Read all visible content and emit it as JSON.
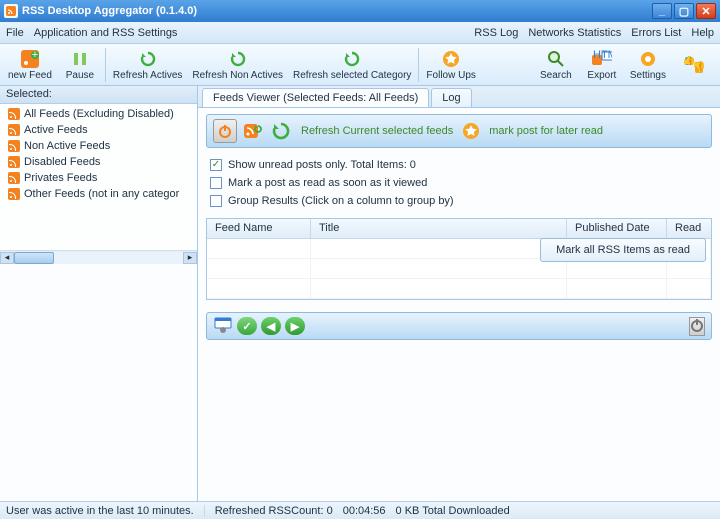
{
  "title": "RSS Desktop Aggregator (0.1.4.0)",
  "menu": {
    "file": "File",
    "settings": "Application and RSS Settings",
    "rsslog": "RSS Log",
    "netstat": "Networks Statistics",
    "errors": "Errors List",
    "help": "Help"
  },
  "toolbar": {
    "newFeed": "new Feed",
    "pause": "Pause",
    "refreshActives": "Refresh Actives",
    "refreshNonActives": "Refresh Non Actives",
    "refreshSelectedCategory": "Refresh selected Category",
    "followUps": "Follow Ups",
    "search": "Search",
    "export": "Export",
    "settings": "Settings",
    "exportHtml": "HTML"
  },
  "sidebar": {
    "head": "Selected:",
    "items": [
      "All Feeds (Excluding Disabled)",
      "Active Feeds",
      "Non Active Feeds",
      "Disabled Feeds",
      "Privates Feeds",
      "Other Feeds (not in any categor"
    ]
  },
  "tabs": {
    "viewer": "Feeds Viewer (Selected Feeds: All Feeds)",
    "log": "Log"
  },
  "actionbar": {
    "refreshText": "Refresh Current selected feeds",
    "markLaterText": "mark post for later read"
  },
  "options": {
    "showUnread": "Show unread posts only. Total Items: 0",
    "markAsRead": "Mark a post as read as soon as it viewed",
    "groupResults": "Group Results (Click on a column to group by)",
    "markAllBtn": "Mark all RSS Items as read"
  },
  "grid": {
    "feedName": "Feed Name",
    "title": "Title",
    "publishedDate": "Published Date",
    "read": "Read"
  },
  "status": {
    "activity": "User was active in the last 10 minutes.",
    "refreshCount": "Refreshed RSSCount: 0",
    "timer": "00:04:56",
    "download": "0 KB Total Downloaded"
  }
}
